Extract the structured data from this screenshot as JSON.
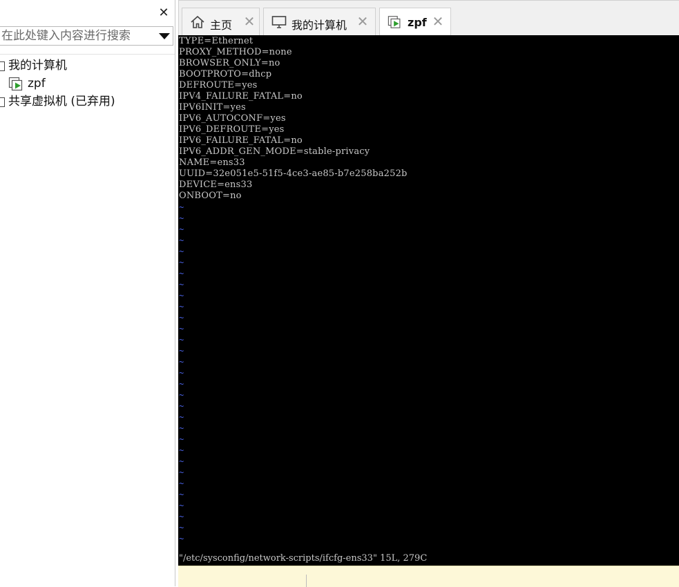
{
  "sidebar": {
    "search_placeholder": "在此处键入内容进行搜索",
    "tree": [
      {
        "label": "我的计算机"
      },
      {
        "label": "zpf"
      },
      {
        "label": "共享虚拟机 (已弃用)"
      }
    ]
  },
  "tabs": [
    {
      "label": "主页",
      "icon": "home-icon"
    },
    {
      "label": "我的计算机",
      "icon": "monitor-icon"
    },
    {
      "label": "zpf",
      "icon": "vm-running-icon",
      "active": true
    }
  ],
  "terminal": {
    "lines": [
      "TYPE=Ethernet",
      "PROXY_METHOD=none",
      "BROWSER_ONLY=no",
      "BOOTPROTO=dhcp",
      "DEFROUTE=yes",
      "IPV4_FAILURE_FATAL=no",
      "IPV6INIT=yes",
      "IPV6_AUTOCONF=yes",
      "IPV6_DEFROUTE=yes",
      "IPV6_FAILURE_FATAL=no",
      "IPV6_ADDR_GEN_MODE=stable-privacy",
      "NAME=ens33",
      "UUID=32e051e5-51f5-4ce3-ae85-b7e258ba252b",
      "DEVICE=ens33",
      "ONBOOT=no"
    ],
    "tilde_char": "~",
    "status": "\"/etc/sysconfig/network-scripts/ifcfg-ens33\" 15L, 279C"
  },
  "colors": {
    "terminal_bg": "#000000",
    "terminal_text": "#c8c8c8",
    "tilde": "#4a63e8",
    "hint_bg": "#fdf8d8",
    "vm_play_green": "#2e9e2e"
  }
}
